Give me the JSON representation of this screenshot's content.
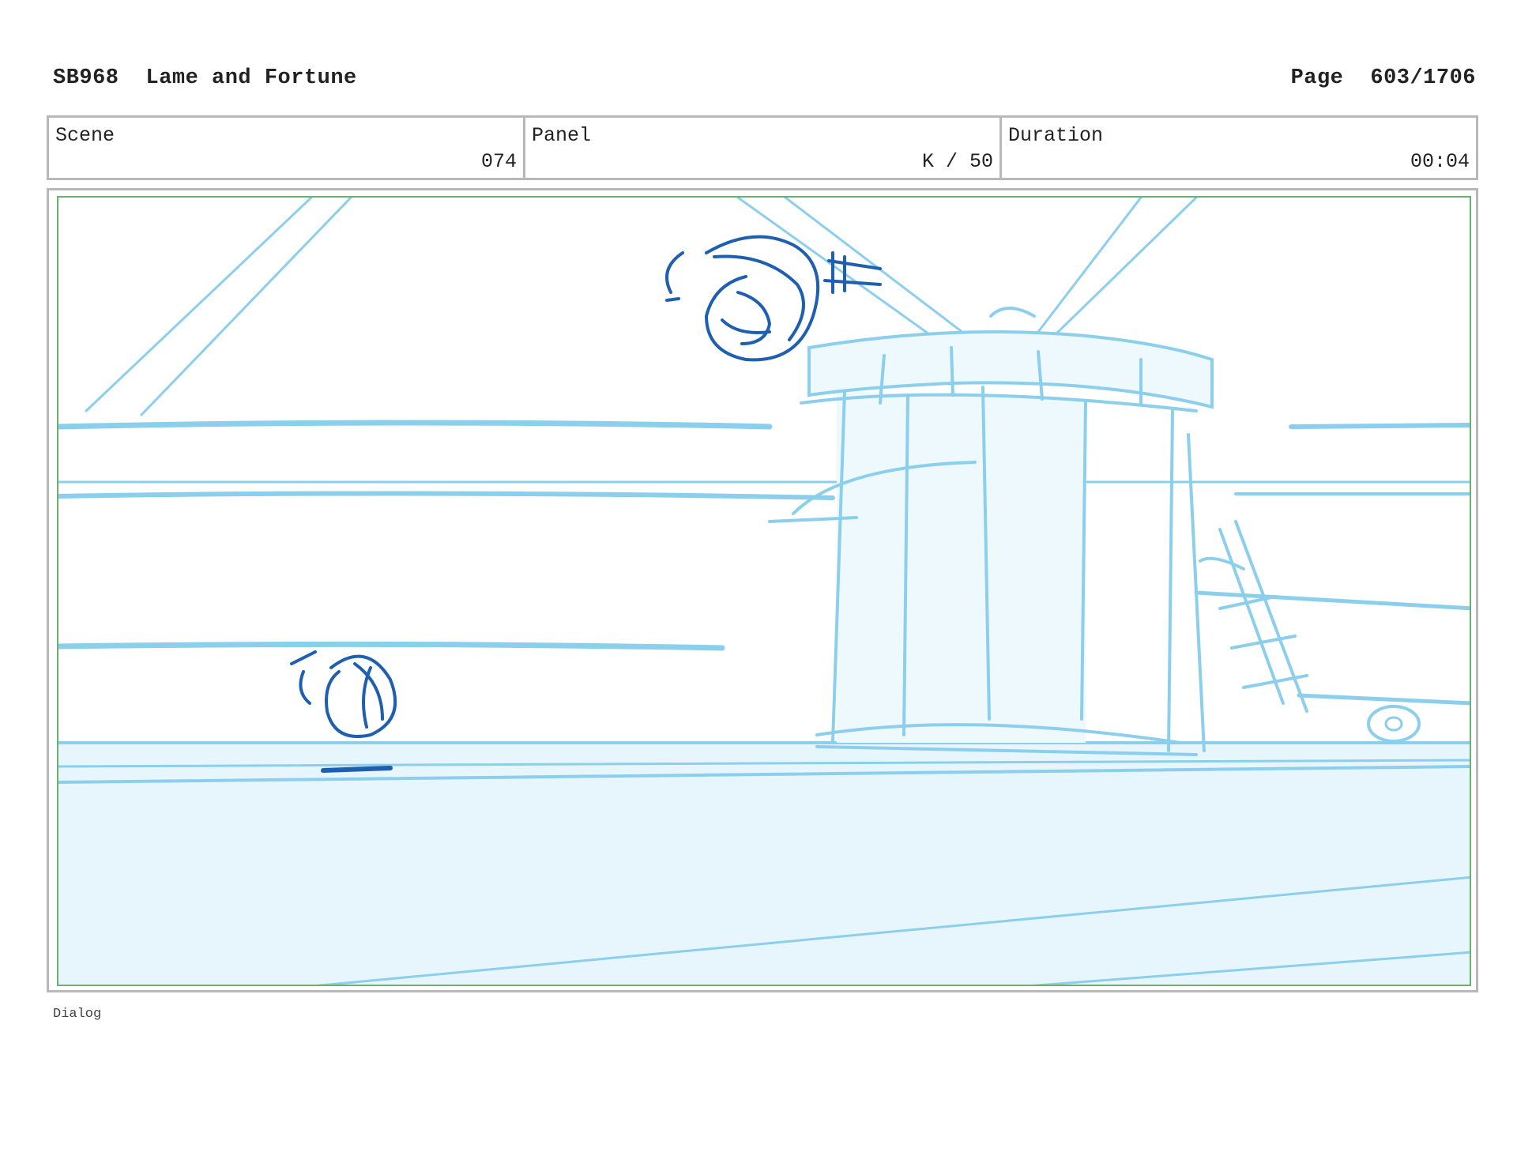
{
  "header": {
    "storyboard_id": "SB968",
    "episode_title": "Lame and Fortune",
    "page_label": "Page",
    "page_value": "603/1706"
  },
  "info": {
    "scene_label": "Scene",
    "scene_value": "074",
    "panel_label": "Panel",
    "panel_value": "K / 50",
    "duration_label": "Duration",
    "duration_value": "00:04"
  },
  "dialog_label": "Dialog",
  "colors": {
    "sketch_light": "#8ccfec",
    "sketch_fill": "#e6f6fc",
    "sketch_dark": "#1f5fb0",
    "frame_border": "#b8b8b8",
    "panel_border": "#6fae73"
  }
}
